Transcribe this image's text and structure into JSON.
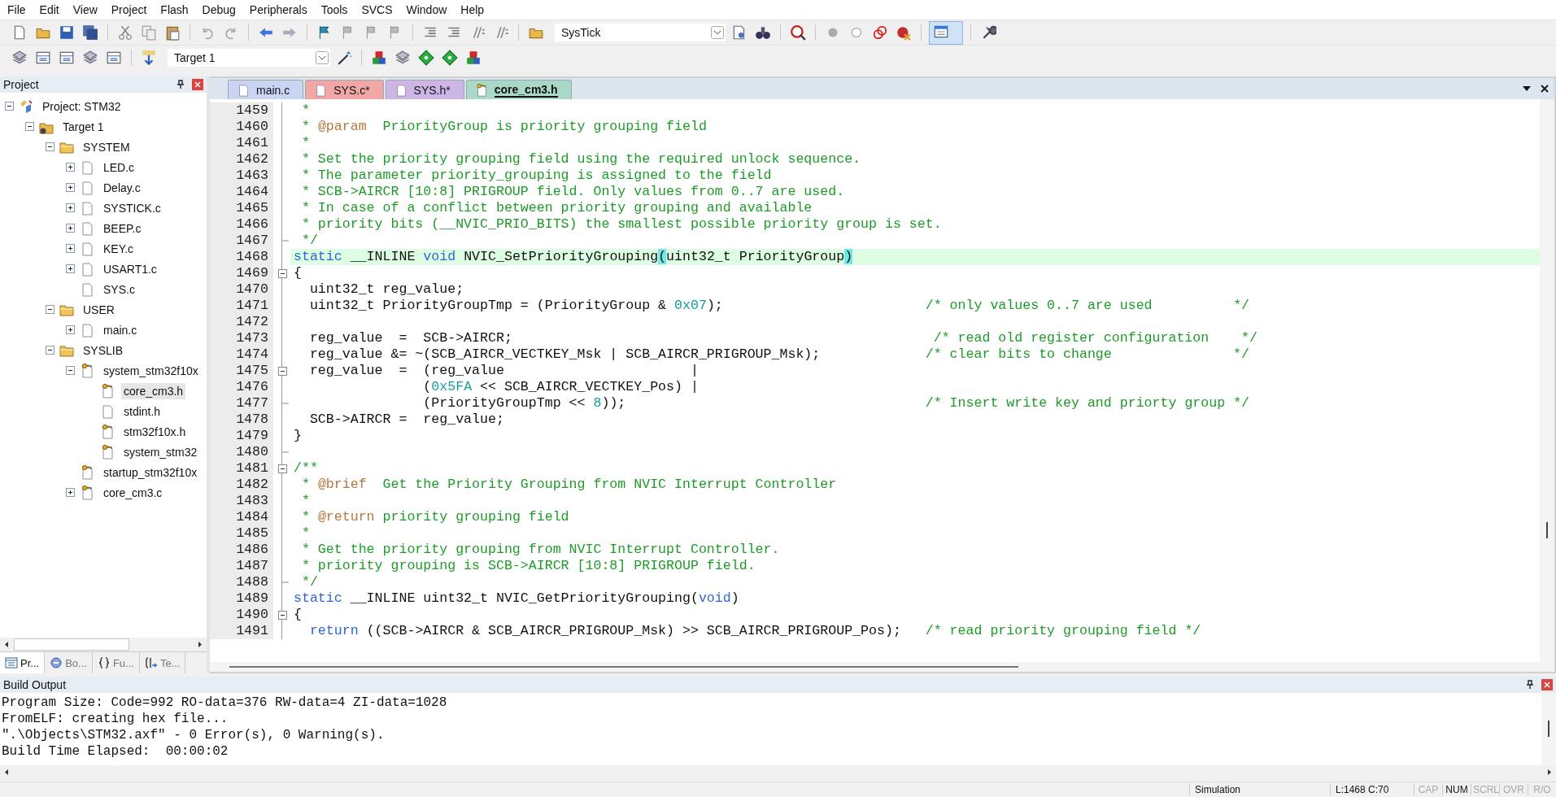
{
  "menu": [
    "File",
    "Edit",
    "View",
    "Project",
    "Flash",
    "Debug",
    "Peripherals",
    "Tools",
    "SVCS",
    "Window",
    "Help"
  ],
  "toolbar": {
    "symbol_combo": "SysTick",
    "target_combo": "Target 1"
  },
  "project_panel": {
    "title": "Project",
    "tree": [
      {
        "label": "Project: STM32",
        "kind": "project",
        "expanded": true,
        "selected": false,
        "children": [
          {
            "label": "Target 1",
            "kind": "target",
            "expanded": true,
            "selected": false,
            "children": [
              {
                "label": "SYSTEM",
                "kind": "folder",
                "expanded": true,
                "selected": false,
                "children": [
                  {
                    "label": "LED.c",
                    "kind": "file",
                    "expanded": false,
                    "selected": false
                  },
                  {
                    "label": "Delay.c",
                    "kind": "file",
                    "expanded": false,
                    "selected": false
                  },
                  {
                    "label": "SYSTICK.c",
                    "kind": "file",
                    "expanded": false,
                    "selected": false
                  },
                  {
                    "label": "BEEP.c",
                    "kind": "file",
                    "expanded": false,
                    "selected": false
                  },
                  {
                    "label": "KEY.c",
                    "kind": "file",
                    "expanded": false,
                    "selected": false
                  },
                  {
                    "label": "USART1.c",
                    "kind": "file",
                    "expanded": false,
                    "selected": false
                  },
                  {
                    "label": "SYS.c",
                    "kind": "file",
                    "selected": false
                  }
                ]
              },
              {
                "label": "USER",
                "kind": "folder",
                "expanded": true,
                "selected": false,
                "children": [
                  {
                    "label": "main.c",
                    "kind": "file",
                    "expanded": false,
                    "selected": false
                  }
                ]
              },
              {
                "label": "SYSLIB",
                "kind": "folder",
                "expanded": true,
                "selected": false,
                "children": [
                  {
                    "label": "system_stm32f10x",
                    "kind": "keyed-file",
                    "expanded": true,
                    "selected": false,
                    "children": [
                      {
                        "label": "core_cm3.h",
                        "kind": "keyed-file",
                        "selected": true
                      },
                      {
                        "label": "stdint.h",
                        "kind": "file",
                        "selected": false
                      },
                      {
                        "label": "stm32f10x.h",
                        "kind": "keyed-file",
                        "selected": false
                      },
                      {
                        "label": "system_stm32",
                        "kind": "keyed-file",
                        "selected": false
                      }
                    ]
                  },
                  {
                    "label": "startup_stm32f10x",
                    "kind": "keyed-file",
                    "selected": false
                  },
                  {
                    "label": "core_cm3.c",
                    "kind": "keyed-file",
                    "expanded": false,
                    "selected": false
                  }
                ]
              }
            ]
          }
        ]
      }
    ],
    "tabs": [
      {
        "label": "Pr...",
        "kind": "project",
        "selected": true
      },
      {
        "label": "Bo...",
        "kind": "books",
        "selected": false
      },
      {
        "label": "Fu...",
        "kind": "functions",
        "selected": false
      },
      {
        "label": "Te...",
        "kind": "templates",
        "selected": false
      }
    ]
  },
  "editor": {
    "tabs": [
      {
        "label": "main.c",
        "kind": "file",
        "color": "#c9d5f2",
        "selected": false
      },
      {
        "label": "SYS.c*",
        "kind": "file",
        "color": "#f2a7a7",
        "selected": false
      },
      {
        "label": "SYS.h*",
        "kind": "file",
        "color": "#cdb6e6",
        "selected": false
      },
      {
        "label": "core_cm3.h",
        "kind": "keyed-file",
        "color": "#a9d9c6",
        "selected": true
      }
    ],
    "lines": [
      {
        "number": "1459",
        "fold_start": false,
        "block_end": false,
        "current": false,
        "tokens": [
          {
            "kind": "comment",
            "text": " *"
          }
        ]
      },
      {
        "number": "1460",
        "fold_start": false,
        "block_end": false,
        "current": false,
        "tokens": [
          {
            "kind": "comment",
            "text": " * "
          },
          {
            "kind": "doctag",
            "text": "@param"
          },
          {
            "kind": "comment",
            "text": "  PriorityGroup is priority grouping field"
          }
        ]
      },
      {
        "number": "1461",
        "fold_start": false,
        "block_end": false,
        "current": false,
        "tokens": [
          {
            "kind": "comment",
            "text": " *"
          }
        ]
      },
      {
        "number": "1462",
        "fold_start": false,
        "block_end": false,
        "current": false,
        "tokens": [
          {
            "kind": "comment",
            "text": " * Set the priority grouping field using the required unlock sequence."
          }
        ]
      },
      {
        "number": "1463",
        "fold_start": false,
        "block_end": false,
        "current": false,
        "tokens": [
          {
            "kind": "comment",
            "text": " * The parameter priority_grouping is assigned to the field"
          }
        ]
      },
      {
        "number": "1464",
        "fold_start": false,
        "block_end": false,
        "current": false,
        "tokens": [
          {
            "kind": "comment",
            "text": " * SCB->AIRCR [10:8] PRIGROUP field. Only values from 0..7 are used."
          }
        ]
      },
      {
        "number": "1465",
        "fold_start": false,
        "block_end": false,
        "current": false,
        "tokens": [
          {
            "kind": "comment",
            "text": " * In case of a conflict between priority grouping and available"
          }
        ]
      },
      {
        "number": "1466",
        "fold_start": false,
        "block_end": false,
        "current": false,
        "tokens": [
          {
            "kind": "comment",
            "text": " * priority bits (__NVIC_PRIO_BITS) the smallest possible priority group is set."
          }
        ]
      },
      {
        "number": "1467",
        "fold_start": false,
        "block_end": true,
        "current": false,
        "tokens": [
          {
            "kind": "comment",
            "text": " */"
          }
        ]
      },
      {
        "number": "1468",
        "fold_start": false,
        "block_end": false,
        "current": true,
        "tokens": [
          {
            "kind": "keyword",
            "text": "static"
          },
          {
            "kind": "plain",
            "text": " __INLINE "
          },
          {
            "kind": "keyword",
            "text": "void"
          },
          {
            "kind": "plain",
            "text": " NVIC_SetPriorityGrouping"
          },
          {
            "kind": "match",
            "text": "("
          },
          {
            "kind": "plain",
            "text": "uint32_t PriorityGroup"
          },
          {
            "kind": "match",
            "text": ")"
          }
        ]
      },
      {
        "number": "1469",
        "fold_start": true,
        "block_end": false,
        "current": false,
        "tokens": [
          {
            "kind": "plain",
            "text": "{"
          }
        ]
      },
      {
        "number": "1470",
        "fold_start": false,
        "block_end": false,
        "current": false,
        "tokens": [
          {
            "kind": "plain",
            "text": "  uint32_t reg_value;"
          }
        ]
      },
      {
        "number": "1471",
        "fold_start": false,
        "block_end": false,
        "current": false,
        "tokens": [
          {
            "kind": "plain",
            "text": "  uint32_t PriorityGroupTmp = (PriorityGroup & "
          },
          {
            "kind": "number",
            "text": "0x07"
          },
          {
            "kind": "plain",
            "text": ");                         "
          },
          {
            "kind": "comment",
            "text": "/* only values 0..7 are used          */"
          }
        ]
      },
      {
        "number": "1472",
        "fold_start": false,
        "block_end": false,
        "current": false
      },
      {
        "number": "1473",
        "fold_start": false,
        "block_end": false,
        "current": false,
        "tokens": [
          {
            "kind": "plain",
            "text": "  reg_value  =  SCB->AIRCR;                                                    "
          },
          {
            "kind": "comment",
            "text": "/* read old register configuration    */"
          }
        ]
      },
      {
        "number": "1474",
        "fold_start": false,
        "block_end": false,
        "current": false,
        "tokens": [
          {
            "kind": "plain",
            "text": "  reg_value &= ~(SCB_AIRCR_VECTKEY_Msk | SCB_AIRCR_PRIGROUP_Msk);             "
          },
          {
            "kind": "comment",
            "text": "/* clear bits to change               */"
          }
        ]
      },
      {
        "number": "1475",
        "fold_start": true,
        "block_end": false,
        "current": false,
        "tokens": [
          {
            "kind": "plain",
            "text": "  reg_value  =  (reg_value                       |"
          }
        ]
      },
      {
        "number": "1476",
        "fold_start": false,
        "block_end": false,
        "current": false,
        "tokens": [
          {
            "kind": "plain",
            "text": "                ("
          },
          {
            "kind": "number",
            "text": "0x5FA"
          },
          {
            "kind": "plain",
            "text": " << SCB_AIRCR_VECTKEY_Pos) |"
          }
        ]
      },
      {
        "number": "1477",
        "fold_start": false,
        "block_end": true,
        "current": false,
        "tokens": [
          {
            "kind": "plain",
            "text": "                (PriorityGroupTmp << "
          },
          {
            "kind": "number",
            "text": "8"
          },
          {
            "kind": "plain",
            "text": "));                                     "
          },
          {
            "kind": "comment",
            "text": "/* Insert write key and priorty group */"
          }
        ]
      },
      {
        "number": "1478",
        "fold_start": false,
        "block_end": false,
        "current": false,
        "tokens": [
          {
            "kind": "plain",
            "text": "  SCB->AIRCR =  reg_value;"
          }
        ]
      },
      {
        "number": "1479",
        "fold_start": false,
        "block_end": false,
        "current": false,
        "tokens": [
          {
            "kind": "plain",
            "text": "}"
          }
        ]
      },
      {
        "number": "1480",
        "fold_start": false,
        "block_end": true,
        "current": false
      },
      {
        "number": "1481",
        "fold_start": true,
        "block_end": false,
        "current": false,
        "tokens": [
          {
            "kind": "comment",
            "text": "/**"
          }
        ]
      },
      {
        "number": "1482",
        "fold_start": false,
        "block_end": false,
        "current": false,
        "tokens": [
          {
            "kind": "comment",
            "text": " * "
          },
          {
            "kind": "doctag",
            "text": "@brief"
          },
          {
            "kind": "comment",
            "text": "  Get the Priority Grouping from NVIC Interrupt Controller"
          }
        ]
      },
      {
        "number": "1483",
        "fold_start": false,
        "block_end": false,
        "current": false,
        "tokens": [
          {
            "kind": "comment",
            "text": " *"
          }
        ]
      },
      {
        "number": "1484",
        "fold_start": false,
        "block_end": false,
        "current": false,
        "tokens": [
          {
            "kind": "comment",
            "text": " * "
          },
          {
            "kind": "doctag",
            "text": "@return"
          },
          {
            "kind": "comment",
            "text": " priority grouping field"
          }
        ]
      },
      {
        "number": "1485",
        "fold_start": false,
        "block_end": false,
        "current": false,
        "tokens": [
          {
            "kind": "comment",
            "text": " *"
          }
        ]
      },
      {
        "number": "1486",
        "fold_start": false,
        "block_end": false,
        "current": false,
        "tokens": [
          {
            "kind": "comment",
            "text": " * Get the priority grouping from NVIC Interrupt Controller."
          }
        ]
      },
      {
        "number": "1487",
        "fold_start": false,
        "block_end": false,
        "current": false,
        "tokens": [
          {
            "kind": "comment",
            "text": " * priority grouping is SCB->AIRCR [10:8] PRIGROUP field."
          }
        ]
      },
      {
        "number": "1488",
        "fold_start": false,
        "block_end": true,
        "current": false,
        "tokens": [
          {
            "kind": "comment",
            "text": " */"
          }
        ]
      },
      {
        "number": "1489",
        "fold_start": false,
        "block_end": false,
        "current": false,
        "tokens": [
          {
            "kind": "keyword",
            "text": "static"
          },
          {
            "kind": "plain",
            "text": " __INLINE uint32_t NVIC_GetPriorityGrouping("
          },
          {
            "kind": "keyword",
            "text": "void"
          },
          {
            "kind": "plain",
            "text": ")"
          }
        ]
      },
      {
        "number": "1490",
        "fold_start": true,
        "block_end": false,
        "current": false,
        "tokens": [
          {
            "kind": "plain",
            "text": "{"
          }
        ]
      },
      {
        "number": "1491",
        "fold_start": false,
        "block_end": false,
        "current": false,
        "tokens": [
          {
            "kind": "keyword",
            "text": "  return"
          },
          {
            "kind": "plain",
            "text": " ((SCB->AIRCR & SCB_AIRCR_PRIGROUP_Msk) >> SCB_AIRCR_PRIGROUP_Pos);   "
          },
          {
            "kind": "comment",
            "text": "/* read priority grouping field */"
          }
        ]
      }
    ]
  },
  "build_output": {
    "title": "Build Output",
    "lines": [
      "Program Size: Code=992 RO-data=376 RW-data=4 ZI-data=1028",
      "FromELF: creating hex file...",
      "\".\\Objects\\STM32.axf\" - 0 Error(s), 0 Warning(s).",
      "Build Time Elapsed:  00:00:02"
    ]
  },
  "status_bar": {
    "mode": "Simulation",
    "position": "L:1468 C:70",
    "indicators": [
      {
        "label": "CAP",
        "on": false
      },
      {
        "label": "NUM",
        "on": true
      },
      {
        "label": "SCRL",
        "on": false
      },
      {
        "label": "OVR",
        "on": false
      },
      {
        "label": "R/O",
        "on": false
      }
    ]
  }
}
